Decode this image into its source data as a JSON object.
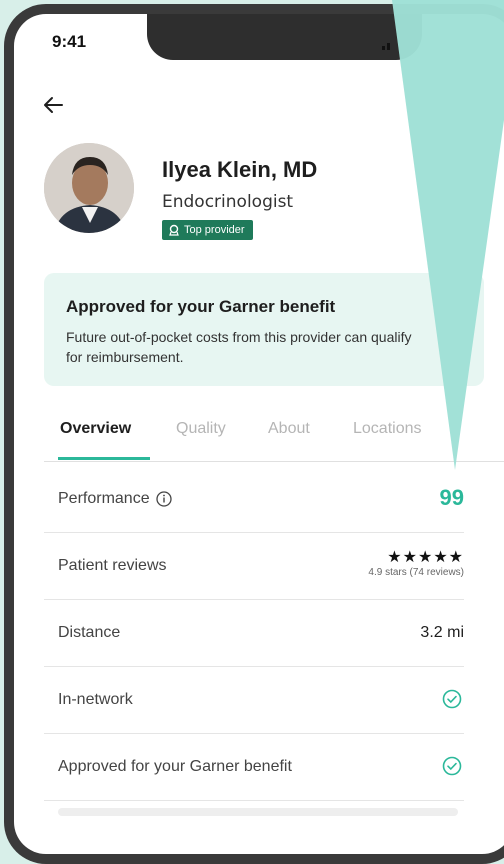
{
  "status_bar": {
    "time": "9:41"
  },
  "doctor": {
    "name": "Ilyea Klein, MD",
    "specialty": "Endocrinologist",
    "badge": "Top provider"
  },
  "benefit": {
    "title": "Approved for your Garner benefit",
    "description": "Future out-of-pocket costs from this provider can qualify for reimbursement."
  },
  "tabs": [
    {
      "label": "Overview"
    },
    {
      "label": "Quality"
    },
    {
      "label": "About"
    },
    {
      "label": "Locations"
    }
  ],
  "rows": {
    "performance": {
      "label": "Performance",
      "value": "99"
    },
    "reviews": {
      "label": "Patient reviews",
      "stars": "★★★★★",
      "caption": "4.9 stars (74 reviews)"
    },
    "distance": {
      "label": "Distance",
      "value": "3.2 mi"
    },
    "in_network": {
      "label": "In-network"
    },
    "approved": {
      "label": "Approved for your Garner benefit"
    }
  },
  "colors": {
    "accent": "#2bb89a",
    "badge": "#1f7a5a",
    "card": "#e7f6f2",
    "pointer": "#9fe0d6"
  }
}
